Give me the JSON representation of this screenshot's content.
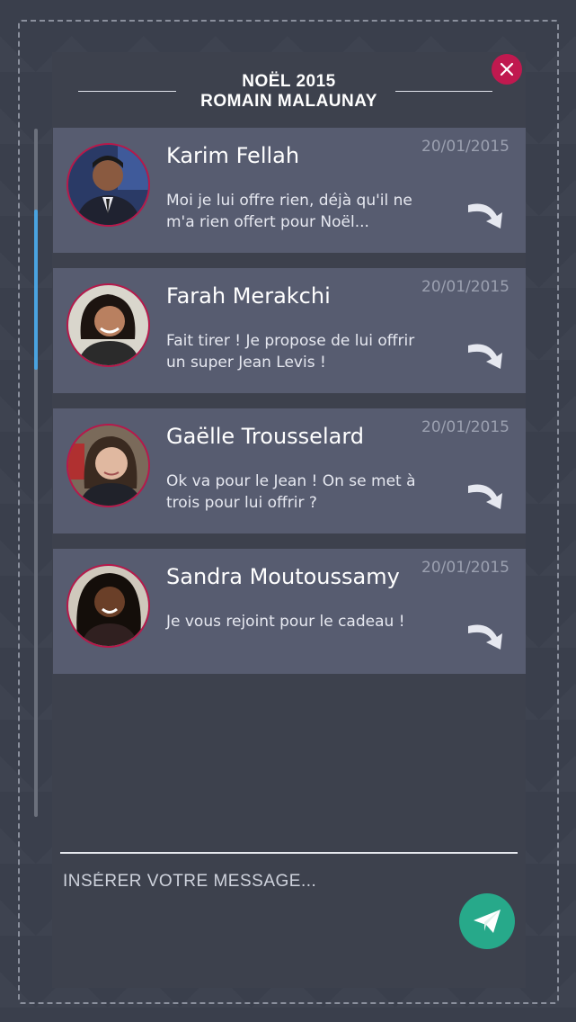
{
  "header": {
    "line1": "NOËL 2015",
    "line2": "ROMAIN MALAUNAY"
  },
  "messages": [
    {
      "name": "Karim Fellah",
      "date": "20/01/2015",
      "text": "Moi je lui offre rien, déjà qu'il ne m'a rien offert pour Noël..."
    },
    {
      "name": "Farah Merakchi",
      "date": "20/01/2015",
      "text": "Fait tirer !  Je propose de lui offrir un super Jean Levis !"
    },
    {
      "name": "Gaëlle Trousselard",
      "date": "20/01/2015",
      "text": "Ok va pour le Jean !  On se met à trois pour lui offrir ?"
    },
    {
      "name": "Sandra Moutoussamy",
      "date": "20/01/2015",
      "text": "Je vous rejoint pour le cadeau !"
    }
  ],
  "composer": {
    "placeholder": "INSÉRER VOTRE MESSAGE..."
  },
  "colors": {
    "background": "#3a3f4c",
    "card": "#575c70",
    "accent_close": "#c0194f",
    "accent_send": "#27a98a",
    "scroll_thumb": "#4aa3e0"
  }
}
